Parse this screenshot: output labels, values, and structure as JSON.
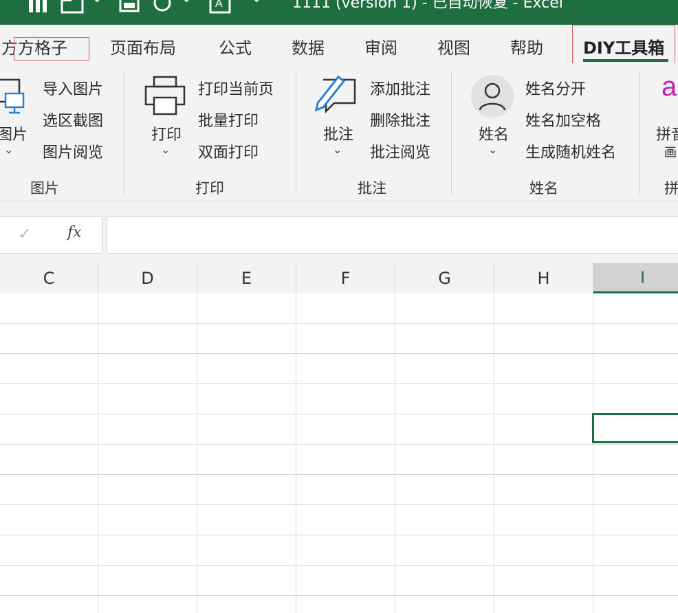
{
  "window": {
    "title": "1111 (version 1)  -  已自动恢复  -  Excel"
  },
  "tabs": [
    {
      "label": "方方格子"
    },
    {
      "label": "页面布局"
    },
    {
      "label": "公式"
    },
    {
      "label": "数据"
    },
    {
      "label": "审阅"
    },
    {
      "label": "视图"
    },
    {
      "label": "帮助"
    },
    {
      "label": "DIY工具箱",
      "active": true
    }
  ],
  "ribbon": {
    "picture": {
      "big_label": "图片",
      "items": [
        "导入图片",
        "选区截图",
        "图片阅览"
      ],
      "group": "图片"
    },
    "print": {
      "big_label": "打印",
      "items": [
        "打印当前页",
        "批量打印",
        "双面打印"
      ],
      "group": "打印"
    },
    "comment": {
      "big_label": "批注",
      "items": [
        "添加批注",
        "删除批注",
        "批注阅览"
      ],
      "group": "批注"
    },
    "name": {
      "big_label": "姓名",
      "items": [
        "姓名分开",
        "姓名加空格",
        "生成随机姓名"
      ],
      "group": "姓名"
    },
    "pinyin": {
      "big_label": "拼音",
      "sub_label": "画",
      "group": "拼"
    }
  },
  "formula_bar": {
    "cancel_symbol": "✕",
    "confirm_symbol": "✓",
    "fx_label": "fx",
    "value": ""
  },
  "columns": [
    "C",
    "D",
    "E",
    "F",
    "G",
    "H",
    "I"
  ],
  "selected_column": "I",
  "colors": {
    "excel_green": "#1e6e3f",
    "highlight_red": "#e05b5b",
    "pinyin_magenta": "#c21fb2"
  }
}
